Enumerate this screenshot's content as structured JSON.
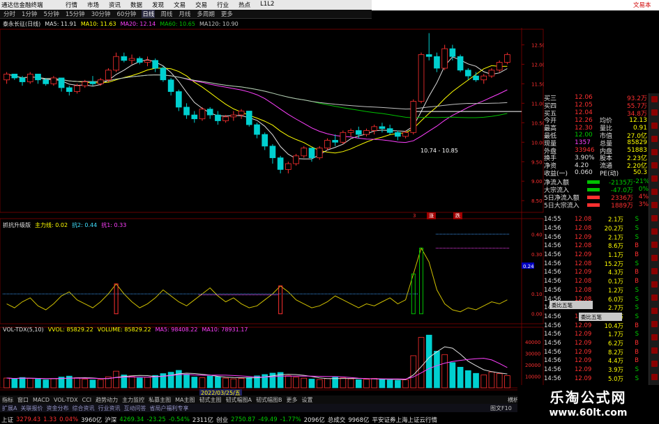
{
  "titlebar": {
    "app_name": "通达信金融终端",
    "menus": [
      "行情",
      "市场",
      "资讯",
      "数据",
      "发现",
      "文易",
      "交易",
      "行业",
      "热点",
      "L1L2"
    ],
    "right_label": "文易本"
  },
  "periods": {
    "items": [
      "分时",
      "1分钟",
      "5分钟",
      "15分钟",
      "30分钟",
      "60分钟",
      "日线",
      "周线",
      "月线",
      "多周期",
      "更多"
    ],
    "selected": "日线"
  },
  "main_chart": {
    "stock_label": "泰永长征(日线)",
    "ma": [
      {
        "label": "MA5: 11.91",
        "color": "#e0e0e0"
      },
      {
        "label": "MA10: 11.63",
        "color": "#ffff00"
      },
      {
        "label": "MA20: 12.14",
        "color": "#ff40ff"
      },
      {
        "label": "MA60: 10.65",
        "color": "#00c000"
      },
      {
        "label": "MA120: 10.90",
        "color": "#c0c0c0"
      }
    ],
    "range_label": "10.74 - 10.85"
  },
  "indicator": {
    "name": "抓抗升级版",
    "line1": "主力线: 0.02",
    "line2": "抗2: 0.44",
    "line3": "抗1: 0.33"
  },
  "volume": {
    "labels": [
      "VOL-TDX(5,10)",
      "VVOL: 85829.22",
      "VOLUME: 85829.22",
      "MA5: 98408.22",
      "MA10: 78931.17"
    ]
  },
  "axis_date": "2022/03/25/五",
  "price_ticks": [
    "12.50",
    "12.00",
    "11.50",
    "11.00",
    "10.50",
    "10.00",
    "9.50",
    "9.00",
    "8.50"
  ],
  "ind_ticks": [
    "0.40",
    "0.30",
    "0.24",
    "0.10",
    "0.00"
  ],
  "vol_ticks": [
    "40000",
    "30000",
    "20000",
    "10000"
  ],
  "badges": [
    {
      "text": "3"
    },
    {
      "text": "涨"
    },
    {
      "text": "跌"
    }
  ],
  "quotes": [
    {
      "l": "买三",
      "v": "12.06",
      "r": "93.2万",
      "vc": "up"
    },
    {
      "l": "买四",
      "v": "12.05",
      "r": "55.7万",
      "vc": "up"
    },
    {
      "l": "买五",
      "v": "12.04",
      "r": "34.8万",
      "vc": "up"
    },
    {
      "l": "今开",
      "v": "12.26",
      "r2": "均价",
      "r": "12.13",
      "vc": "up"
    },
    {
      "l": "最高",
      "v": "12.30",
      "r2": "量比",
      "r": "0.91",
      "vc": "up"
    },
    {
      "l": "最低",
      "v": "12.00",
      "r2": "市值",
      "r": "27.0亿",
      "vc": "dn"
    },
    {
      "l": "现量",
      "v": "1357",
      "r2": "总量",
      "r": "85829",
      "vc": "mg"
    },
    {
      "l": "外盘",
      "v": "33946",
      "r2": "内盘",
      "r": "51883",
      "vc": "up"
    },
    {
      "l": "换手",
      "v": "3.90%",
      "r2": "股本",
      "r": "2.23亿",
      "vc": "wh"
    },
    {
      "l": "净资",
      "v": "4.20",
      "r2": "流通",
      "r": "2.20亿",
      "vc": "wh"
    },
    {
      "l": "收益(一)",
      "v": "0.060",
      "r2": "PE(动)",
      "r": "50.3",
      "vc": "wh"
    }
  ],
  "flows": [
    {
      "l": "净流入额",
      "v": "-2135万",
      "p": "-21%"
    },
    {
      "l": "大宗流入",
      "v": "-47.0万",
      "p": "0%"
    },
    {
      "l": "5日净流入额",
      "v": "2336万",
      "p": "4%"
    },
    {
      "l": "5日大宗流入",
      "v": "1889万",
      "p": "3%"
    }
  ],
  "ticks": [
    {
      "t": "14:55",
      "p": "12.08",
      "v": "2.1万",
      "s": "S"
    },
    {
      "t": "14:56",
      "p": "12.08",
      "v": "20.2万",
      "s": "S"
    },
    {
      "t": "14:56",
      "p": "12.09",
      "v": "2.1万",
      "s": "S"
    },
    {
      "t": "14:56",
      "p": "12.08",
      "v": "8.6万",
      "s": "B"
    },
    {
      "t": "14:56",
      "p": "12.09",
      "v": "1.1万",
      "s": "B"
    },
    {
      "t": "14:56",
      "p": "12.08",
      "v": "15.2万",
      "s": "S"
    },
    {
      "t": "14:56",
      "p": "12.09",
      "v": "4.3万",
      "s": "B"
    },
    {
      "t": "14:56",
      "p": "12.08",
      "v": "0.1万",
      "s": "B"
    },
    {
      "t": "14:56",
      "p": "12.08",
      "v": "1.2万",
      "s": "S"
    },
    {
      "t": "14:56",
      "p": "12.08",
      "v": "6.0万",
      "s": "S"
    },
    {
      "t": "14:56",
      "p": "12.08",
      "v": "2.7万",
      "s": "S"
    },
    {
      "t": "14:56",
      "p": "12.09",
      "v": "10.8万",
      "s": "S"
    },
    {
      "t": "14:56",
      "p": "12.09",
      "v": "10.4万",
      "s": "B"
    },
    {
      "t": "14:56",
      "p": "12.09",
      "v": "1.7万",
      "s": "S"
    },
    {
      "t": "14:56",
      "p": "12.09",
      "v": "6.2万",
      "s": "B"
    },
    {
      "t": "14:56",
      "p": "12.09",
      "v": "8.2万",
      "s": "B"
    },
    {
      "t": "14:56",
      "p": "12.09",
      "v": "4.4万",
      "s": "B"
    },
    {
      "t": "14:56",
      "p": "12.09",
      "v": "3.9万",
      "s": "S"
    },
    {
      "t": "14:56",
      "p": "12.09",
      "v": "5.0万",
      "s": "S"
    }
  ],
  "panel_btn1": "委比五笔",
  "panel_btn2": "委比五笔",
  "bottom_tabs": [
    "指标",
    "窗口",
    "MACD",
    "VOL-TDX",
    "CCI",
    "趋势动力",
    "主力监控",
    "私募主图",
    "MA主图",
    "韧式主图",
    "韧式幅图A",
    "韧式幅图B",
    "更多",
    "设置"
  ],
  "bottom_tabs2": [
    "扩展A",
    "关联报价",
    "资金分布",
    "综合资讯",
    "行业资讯",
    "互动问答",
    "省局户福利专享"
  ],
  "tabs2_right": "图文F10",
  "corner_label": "横析",
  "status": [
    {
      "t": "上证",
      "c": "wh"
    },
    {
      "t": "3279.43",
      "c": "up"
    },
    {
      "t": "1.33",
      "c": "up"
    },
    {
      "t": "0.04%",
      "c": "up"
    },
    {
      "t": "3960亿",
      "c": "wh"
    },
    {
      "t": "沪深",
      "c": "wh"
    },
    {
      "t": "4269.34",
      "c": "dn"
    },
    {
      "t": "-23.25",
      "c": "dn"
    },
    {
      "t": "-0.54%",
      "c": "dn"
    },
    {
      "t": "2311亿",
      "c": "wh"
    },
    {
      "t": "创业",
      "c": "wh"
    },
    {
      "t": "2750.87",
      "c": "dn"
    },
    {
      "t": "-49.49",
      "c": "dn"
    },
    {
      "t": "-1.77%",
      "c": "dn"
    },
    {
      "t": "2096亿",
      "c": "wh"
    },
    {
      "t": "总成交",
      "c": "wh"
    },
    {
      "t": "9968亿",
      "c": "wh"
    },
    {
      "t": "平安证券上海上证云行情",
      "c": "wh"
    }
  ],
  "watermark": {
    "line1": "乐淘公式网",
    "line2": "www.60lt.com"
  },
  "colors": {
    "up": "#ff3030",
    "down": "#00d0d0",
    "ma5": "#e0e0e0",
    "ma10": "#ffff00",
    "ma20": "#ff40ff",
    "ma60": "#00c000",
    "ma120": "#c0c0c0"
  },
  "chart_data": {
    "type": "candlestick",
    "candles": [
      [
        11.6,
        11.8,
        11.5,
        11.75
      ],
      [
        11.75,
        11.7,
        11.6,
        11.65
      ],
      [
        11.65,
        11.7,
        11.45,
        11.55
      ],
      [
        11.55,
        11.8,
        11.5,
        11.75
      ],
      [
        11.75,
        11.7,
        11.5,
        11.6
      ],
      [
        11.6,
        11.65,
        11.45,
        11.5
      ],
      [
        11.5,
        11.7,
        11.45,
        11.65
      ],
      [
        11.65,
        11.6,
        11.3,
        11.4
      ],
      [
        11.4,
        11.45,
        11.2,
        11.3
      ],
      [
        11.3,
        11.5,
        11.25,
        11.45
      ],
      [
        11.45,
        11.6,
        11.4,
        11.55
      ],
      [
        11.55,
        11.7,
        11.45,
        11.5
      ],
      [
        11.5,
        11.65,
        11.45,
        11.6
      ],
      [
        11.6,
        11.9,
        11.55,
        11.85
      ],
      [
        11.85,
        12.3,
        11.8,
        12.2
      ],
      [
        12.2,
        12.3,
        12.05,
        12.1
      ],
      [
        12.1,
        12.25,
        12.0,
        12.15
      ],
      [
        12.15,
        12.2,
        12.0,
        12.05
      ],
      [
        12.05,
        12.2,
        11.95,
        12.1
      ],
      [
        12.1,
        12.15,
        11.8,
        11.9
      ],
      [
        11.9,
        11.95,
        11.55,
        11.6
      ],
      [
        11.6,
        11.65,
        11.2,
        11.3
      ],
      [
        11.3,
        11.35,
        10.8,
        10.9
      ],
      [
        10.9,
        11.0,
        10.6,
        10.7
      ],
      [
        10.7,
        10.8,
        10.5,
        10.6
      ],
      [
        10.6,
        10.9,
        10.55,
        10.85
      ],
      [
        10.85,
        10.9,
        10.6,
        10.7
      ],
      [
        10.7,
        10.8,
        10.45,
        10.55
      ],
      [
        10.55,
        10.7,
        10.5,
        10.65
      ],
      [
        10.65,
        10.8,
        10.55,
        10.7
      ],
      [
        10.7,
        10.85,
        10.6,
        10.8
      ],
      [
        10.8,
        10.75,
        10.4,
        10.45
      ],
      [
        10.45,
        10.5,
        10.1,
        10.2
      ],
      [
        10.2,
        10.25,
        9.8,
        9.9
      ],
      [
        9.9,
        9.95,
        9.45,
        9.6
      ],
      [
        9.6,
        9.65,
        9.2,
        9.3
      ],
      [
        9.3,
        9.5,
        9.2,
        9.45
      ],
      [
        9.45,
        9.7,
        9.4,
        9.65
      ],
      [
        9.65,
        9.9,
        9.6,
        9.85
      ],
      [
        9.85,
        9.8,
        9.5,
        9.6
      ],
      [
        9.6,
        9.9,
        9.55,
        9.85
      ],
      [
        9.85,
        10.1,
        9.8,
        10.05
      ],
      [
        10.05,
        10.2,
        9.9,
        10.0
      ],
      [
        10.0,
        10.3,
        9.95,
        10.25
      ],
      [
        10.25,
        10.35,
        10.15,
        10.3
      ],
      [
        10.3,
        10.4,
        10.1,
        10.2
      ],
      [
        10.2,
        10.35,
        10.15,
        10.3
      ],
      [
        10.3,
        10.45,
        10.2,
        10.4
      ],
      [
        10.4,
        10.5,
        10.25,
        10.35
      ],
      [
        10.35,
        10.45,
        10.2,
        10.25
      ],
      [
        10.25,
        10.3,
        10.05,
        10.15
      ],
      [
        10.15,
        10.3,
        10.1,
        10.25
      ],
      [
        10.25,
        11.1,
        10.2,
        11.05
      ],
      [
        11.05,
        12.3,
        11.0,
        12.25
      ],
      [
        12.25,
        12.8,
        12.1,
        12.2
      ],
      [
        12.2,
        12.3,
        11.8,
        11.9
      ],
      [
        11.9,
        12.5,
        11.85,
        12.4
      ],
      [
        12.4,
        12.5,
        12.1,
        12.2
      ],
      [
        12.2,
        12.25,
        11.8,
        11.85
      ],
      [
        11.85,
        11.9,
        11.6,
        11.7
      ],
      [
        11.7,
        11.8,
        11.55,
        11.6
      ],
      [
        11.6,
        11.75,
        11.5,
        11.7
      ],
      [
        11.7,
        11.9,
        11.65,
        11.85
      ],
      [
        11.85,
        12.1,
        11.8,
        12.05
      ],
      [
        12.05,
        12.3,
        12.0,
        12.25
      ]
    ],
    "indicator": [
      0.05,
      0.03,
      0.06,
      0.08,
      0.04,
      0.02,
      0.05,
      0.09,
      0.11,
      0.07,
      0.05,
      0.03,
      0.06,
      0.1,
      0.15,
      0.1,
      0.06,
      0.03,
      0.05,
      0.08,
      0.12,
      0.09,
      0.06,
      0.04,
      0.07,
      0.1,
      0.13,
      0.09,
      0.06,
      0.08,
      0.05,
      0.03,
      0.04,
      0.07,
      0.1,
      0.14,
      0.11,
      0.07,
      0.05,
      0.03,
      0.04,
      0.06,
      0.09,
      0.07,
      0.05,
      0.03,
      0.05,
      0.04,
      0.06,
      0.08,
      0.05,
      0.07,
      0.2,
      0.33,
      0.26,
      0.12,
      0.05,
      0.02,
      0.01,
      0.03,
      0.02,
      0.04,
      0.06,
      0.05,
      0.07
    ],
    "volume": [
      8500,
      7800,
      9000,
      8200,
      7600,
      6900,
      8100,
      9400,
      10200,
      8800,
      7500,
      6800,
      7200,
      9600,
      14500,
      11200,
      9800,
      8600,
      9200,
      10800,
      12400,
      13600,
      15200,
      11800,
      9400,
      8800,
      10200,
      9600,
      8400,
      7800,
      8200,
      9000,
      10400,
      11600,
      12800,
      13400,
      10600,
      9200,
      8400,
      7600,
      7200,
      8000,
      9200,
      8600,
      7800,
      7000,
      7400,
      8200,
      7600,
      6800,
      6400,
      7000,
      28000,
      44000,
      46000,
      32000,
      29000,
      22000,
      18000,
      15000,
      12600,
      11200,
      13800,
      12400,
      10600
    ],
    "vol_ylim": [
      0,
      48000
    ],
    "ind_ylim": [
      -0.05,
      0.45
    ],
    "ylim": [
      8.2,
      12.9
    ]
  }
}
